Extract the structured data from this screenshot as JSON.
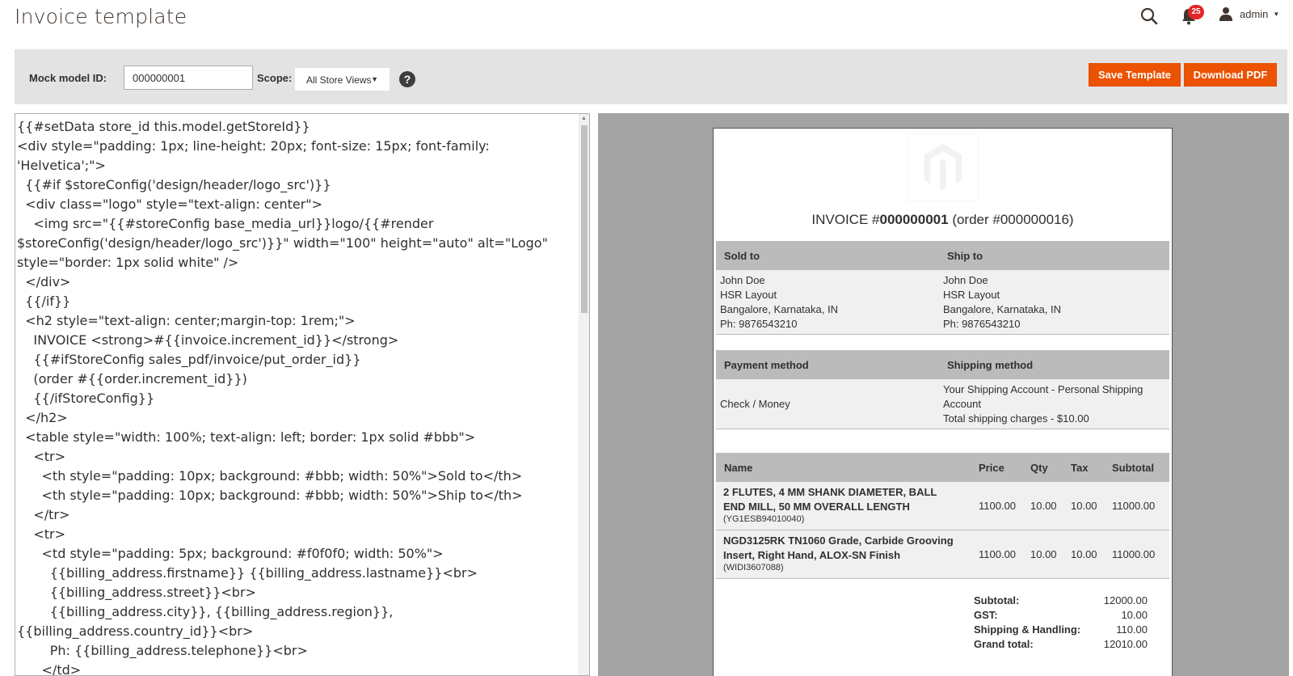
{
  "header": {
    "title": "Invoice template",
    "notification_count": "25",
    "user_name": "admin"
  },
  "toolbar": {
    "mock_model_label": "Mock model ID:",
    "mock_model_value": "000000001",
    "scope_label": "Scope:",
    "scope_value": "All Store Views",
    "help_glyph": "?",
    "save_label": "Save Template",
    "download_label": "Download PDF",
    "accent_color": "#eb5202"
  },
  "editor": {
    "lines": [
      "{{#setData store_id this.model.getStoreId}}",
      "<div style=\"padding: 1px; line-height: 20px; font-size: 15px; font-family:",
      "'Helvetica';\">",
      "  {{#if $storeConfig('design/header/logo_src')}}",
      "  <div class=\"logo\" style=\"text-align: center\">",
      "    <img src=\"{{#storeConfig base_media_url}}logo/{{#render",
      "$storeConfig('design/header/logo_src')}}\" width=\"100\" height=\"auto\" alt=\"Logo\"",
      "style=\"border: 1px solid white\" />",
      "  </div>",
      "  {{/if}}",
      "  <h2 style=\"text-align: center;margin-top: 1rem;\">",
      "    INVOICE <strong>#{{invoice.increment_id}}</strong>",
      "    {{#ifStoreConfig sales_pdf/invoice/put_order_id}}",
      "    (order #{{order.increment_id}})",
      "    {{/ifStoreConfig}}",
      "  </h2>",
      "  <table style=\"width: 100%; text-align: left; border: 1px solid #bbb\">",
      "    <tr>",
      "      <th style=\"padding: 10px; background: #bbb; width: 50%\">Sold to</th>",
      "      <th style=\"padding: 10px; background: #bbb; width: 50%\">Ship to</th>",
      "    </tr>",
      "    <tr>",
      "      <td style=\"padding: 5px; background: #f0f0f0; width: 50%\">",
      "        {{billing_address.firstname}} {{billing_address.lastname}}<br>",
      "        {{billing_address.street}}<br>",
      "        {{billing_address.city}}, {{billing_address.region}},",
      "{{billing_address.country_id}}<br>",
      "        Ph: {{billing_address.telephone}}<br>",
      "      </td>"
    ]
  },
  "invoice": {
    "title_prefix": "INVOICE #",
    "invoice_number": "000000001",
    "order_ref": "(order #000000016)",
    "sold_to_label": "Sold to",
    "ship_to_label": "Ship to",
    "sold_to": [
      "John Doe",
      "HSR Layout",
      "Bangalore, Karnataka, IN",
      "Ph: 9876543210"
    ],
    "ship_to": [
      "John Doe",
      "HSR Layout",
      "Bangalore, Karnataka, IN",
      "Ph: 9876543210"
    ],
    "payment_label": "Payment method",
    "shipping_label": "Shipping method",
    "payment_value": "Check / Money",
    "shipping_lines": [
      "Your Shipping Account - Personal Shipping",
      "Account",
      "Total shipping charges - $10.00"
    ],
    "columns": [
      "Name",
      "Price",
      "Qty",
      "Tax",
      "Subtotal"
    ],
    "items": [
      {
        "name_lines": [
          "2 FLUTES, 4 MM SHANK DIAMETER, BALL",
          "END MILL, 50 MM OVERALL LENGTH"
        ],
        "sku": "(YG1ESB94010040)",
        "price": "1100.00",
        "qty": "10.00",
        "tax": "10.00",
        "subtotal": "11000.00"
      },
      {
        "name_lines": [
          "NGD3125RK TN1060 Grade, Carbide Grooving",
          "Insert, Right Hand, ALOX-SN Finish"
        ],
        "sku": "(WIDI3607088)",
        "price": "1100.00",
        "qty": "10.00",
        "tax": "10.00",
        "subtotal": "11000.00"
      }
    ],
    "totals": [
      {
        "label": "Subtotal:",
        "value": "12000.00"
      },
      {
        "label": "GST:",
        "value": "10.00"
      },
      {
        "label": "Shipping & Handling:",
        "value": "110.00"
      },
      {
        "label": "Grand total:",
        "value": "12010.00"
      }
    ]
  }
}
